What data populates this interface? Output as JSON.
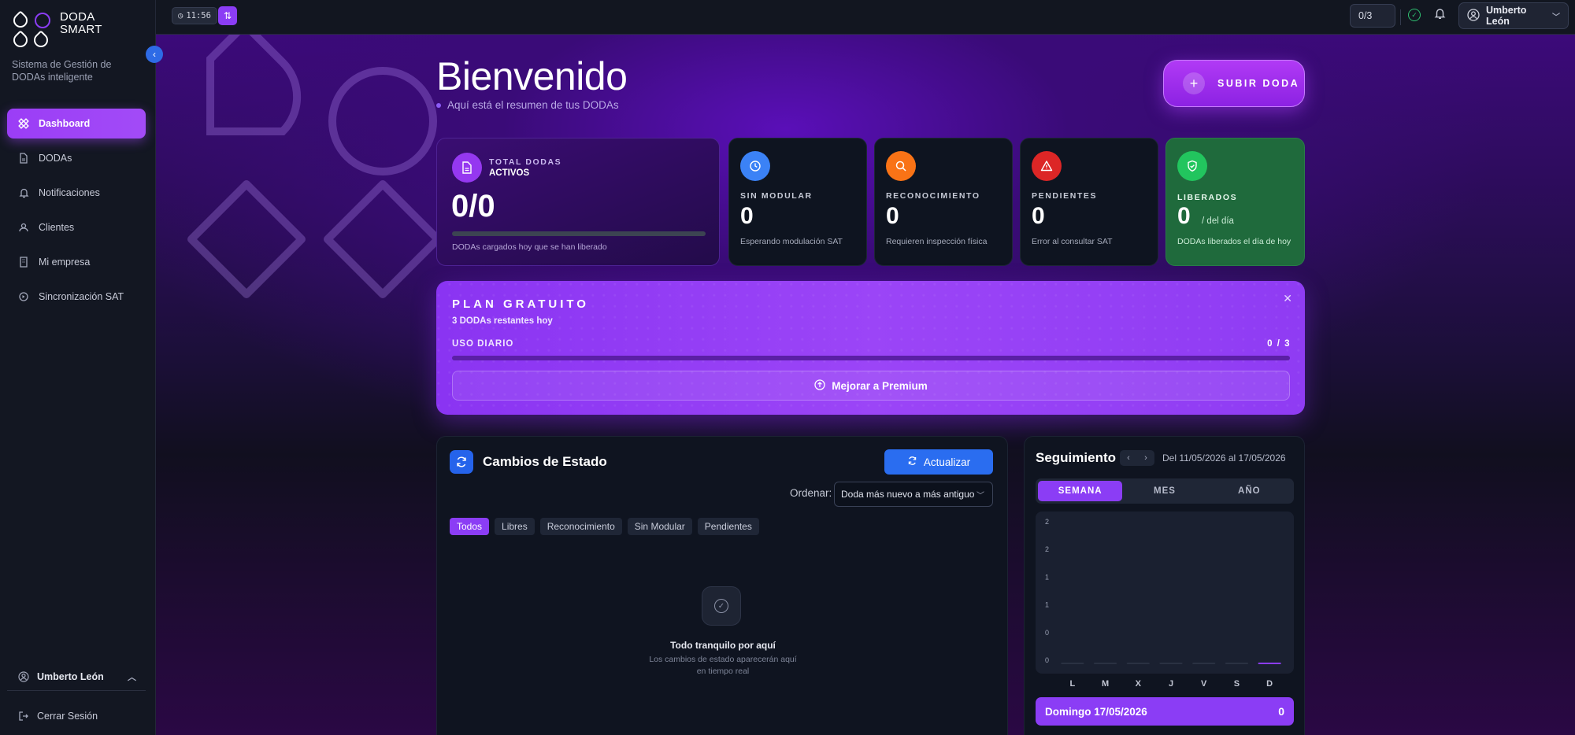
{
  "app": {
    "logo_line1": "DODA",
    "logo_line2": "SMART",
    "tagline": "Sistema de Gestión de DODAs inteligente"
  },
  "sidebar": {
    "items": [
      {
        "label": "Dashboard",
        "icon": "grid-icon",
        "active": true
      },
      {
        "label": "DODAs",
        "icon": "document-icon",
        "active": false
      },
      {
        "label": "Notificaciones",
        "icon": "bell-icon",
        "active": false
      },
      {
        "label": "Clientes",
        "icon": "users-icon",
        "active": false
      },
      {
        "label": "Mi empresa",
        "icon": "building-icon",
        "active": false
      },
      {
        "label": "Sincronización SAT",
        "icon": "sync-icon",
        "active": false
      }
    ],
    "user_name": "Umberto León",
    "logout_label": "Cerrar Sesión"
  },
  "topbar": {
    "clock": "11:56",
    "quota": "0/3",
    "user_name": "Umberto León"
  },
  "header": {
    "title": "Bienvenido",
    "subtitle": "Aquí está el resumen de tus DODAs",
    "upload_label": "SUBIR DODA"
  },
  "stats": {
    "total": {
      "label1": "TOTAL DODAS",
      "label2": "ACTIVOS",
      "value": "0/0",
      "progress": 0,
      "desc": "DODAs cargados hoy que se han liberado"
    },
    "sin_modular": {
      "label": "SIN MODULAR",
      "value": "0",
      "desc": "Esperando modulación SAT",
      "color": "#3b82f6"
    },
    "reconocimiento": {
      "label": "RECONOCIMIENTO",
      "value": "0",
      "desc": "Requieren inspección física",
      "color": "#f97316"
    },
    "pendientes": {
      "label": "PENDIENTES",
      "value": "0",
      "desc": "Error al consultar SAT",
      "color": "#dc2626"
    },
    "liberados": {
      "label": "LIBERADOS",
      "value": "0",
      "unit": "/ del día",
      "desc": "DODAs liberados el día de hoy",
      "color": "#22c55e"
    }
  },
  "plan": {
    "title": "PLAN GRATUITO",
    "remaining": "3 DODAs restantes hoy",
    "usage_label": "USO DIARIO",
    "usage_count": "0 / 3",
    "usage_fraction": 0,
    "premium_label": "Mejorar a Premium"
  },
  "cambios": {
    "title": "Cambios de Estado",
    "refresh_label": "Actualizar",
    "order_label": "Ordenar:",
    "order_value": "Doda más nuevo a más antiguo",
    "filters": [
      "Todos",
      "Libres",
      "Reconocimiento",
      "Sin Modular",
      "Pendientes"
    ],
    "active_filter": 0,
    "empty_title": "Todo tranquilo por aquí",
    "empty_sub": "Los cambios de estado aparecerán aquí en tiempo real"
  },
  "seguimiento": {
    "title": "Seguimiento",
    "range": "Del 11/05/2026 al 17/05/2026",
    "tabs": [
      "SEMANA",
      "MES",
      "AÑO"
    ],
    "active_tab": 0,
    "day_label": "Domingo 17/05/2026",
    "day_count": "0"
  },
  "chart_data": {
    "type": "bar",
    "categories": [
      "L",
      "M",
      "X",
      "J",
      "V",
      "S",
      "D"
    ],
    "values": [
      0,
      0,
      0,
      0,
      0,
      0,
      0
    ],
    "highlighted": "D",
    "yticks": [
      "2",
      "2",
      "1",
      "1",
      "0",
      "0"
    ],
    "ylim": [
      0,
      2
    ],
    "accent": "#8b3df5"
  }
}
